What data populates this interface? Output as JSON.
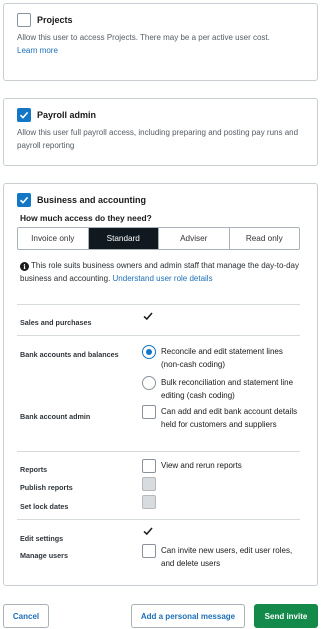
{
  "projects": {
    "title": "Projects",
    "description": "Allow this user to access Projects. There may be a per active user cost.",
    "link": "Learn more",
    "checked": false
  },
  "payroll": {
    "title": "Payroll admin",
    "description": "Allow this user full payroll access, including preparing and posting pay runs and payroll reporting",
    "checked": true
  },
  "business": {
    "title": "Business and accounting",
    "checked": true,
    "question": "How much access do they need?",
    "levels": [
      "Invoice only",
      "Standard",
      "Adviser",
      "Read only"
    ],
    "selected_level": "Standard",
    "info_text": "This role suits business owners and admin staff that manage the day-to-day business and accounting.",
    "info_link": "Understand user role details",
    "sections": {
      "sales_label": "Sales and purchases",
      "bank_label": "Bank accounts and balances",
      "bank_option_1": "Reconcile and edit statement lines (non-cash coding)",
      "bank_option_2": "Bulk reconciliation and statement line editing (cash coding)",
      "bank_admin_label": "Bank account admin",
      "bank_admin_option": "Can add and edit bank account details held for customers and suppliers",
      "reports_label": "Reports",
      "reports_option": "View and rerun reports",
      "publish_label": "Publish reports",
      "lock_label": "Set lock dates",
      "edit_settings_label": "Edit settings",
      "manage_users_label": "Manage users",
      "manage_users_option": "Can invite new users, edit user roles, and delete users"
    }
  },
  "footer": {
    "cancel": "Cancel",
    "personal_message": "Add a personal message",
    "send": "Send invite"
  },
  "colors": {
    "accent": "#1377c5",
    "primary_button": "#138a4a",
    "link": "#1d6fb8"
  }
}
